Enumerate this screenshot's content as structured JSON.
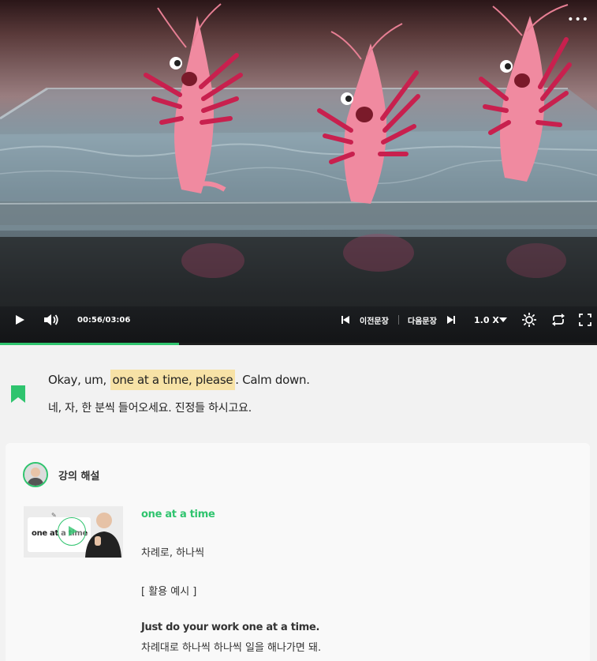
{
  "player": {
    "current_time": "00:56",
    "duration": "03:06",
    "time_separator": "/",
    "prev_sentence_label": "이전문장",
    "next_sentence_label": "다음문장",
    "speed_label": "1.0 X",
    "progress_fraction": 0.3,
    "accent_color": "#2fc46e",
    "icons": [
      "more-icon",
      "play-icon",
      "volume-icon",
      "prev-sentence-icon",
      "next-sentence-icon",
      "caret-down-icon",
      "brightness-icon",
      "loop-icon",
      "fullscreen-icon"
    ]
  },
  "sentence": {
    "english_before": "Okay, um, ",
    "english_highlight": "one at a time, please",
    "english_after": ". Calm down.",
    "korean": "네, 자, 한 분씩 들어오세요. 진정들 하시고요.",
    "highlight_color": "#f7e2a6",
    "bookmark_icon": "bookmark-icon"
  },
  "lecture": {
    "title": "강의 해설",
    "thumbnail_text": "one at a time",
    "term": "one at a time",
    "meaning": "차례로, 하나씩",
    "example_heading": "[ 활용 예시 ]",
    "example_english": "Just do your work one at a time.",
    "example_korean": "차례대로 하나씩 하나씩 일을 해나가면 돼."
  }
}
